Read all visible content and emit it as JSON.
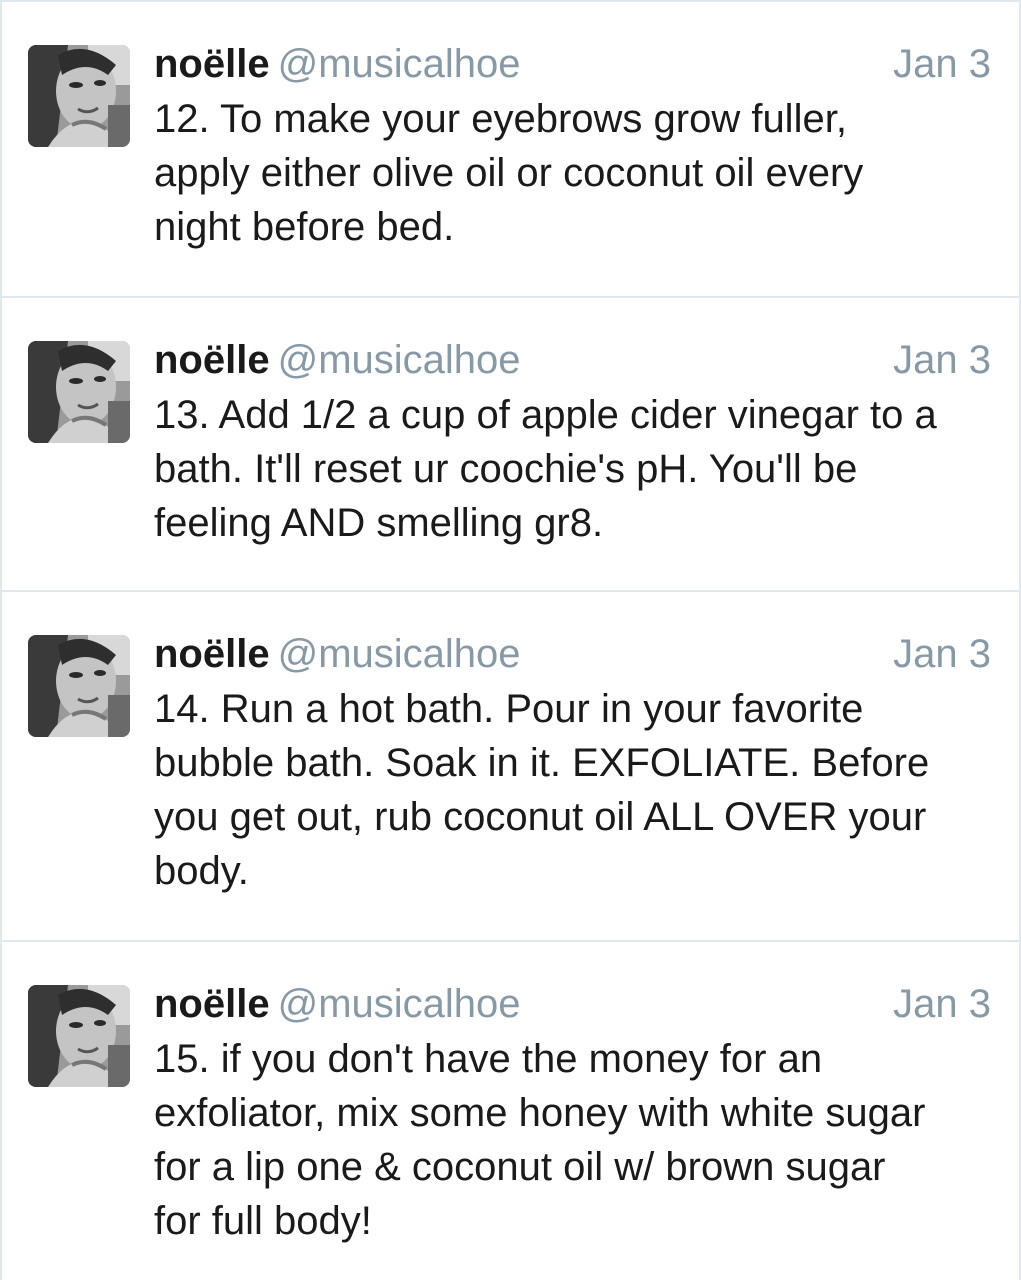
{
  "colors": {
    "border": "#e1e8ed",
    "name": "#1a1a1a",
    "handle": "#8899a6",
    "date": "#8899a6",
    "text": "#1a1a1a"
  },
  "tweets": [
    {
      "name": "noëlle",
      "handle": "@musicalhoe",
      "date": "Jan 3",
      "avatar_icon": "profile-photo-grayscale",
      "text": "12. To make your eyebrows grow fuller,\napply either olive oil or coconut oil every\nnight before bed."
    },
    {
      "name": "noëlle",
      "handle": "@musicalhoe",
      "date": "Jan 3",
      "avatar_icon": "profile-photo-grayscale",
      "text": "13. Add 1/2 a cup of apple cider vinegar to a\nbath. It'll reset ur coochie's pH. You'll be\nfeeling AND smelling gr8."
    },
    {
      "name": "noëlle",
      "handle": "@musicalhoe",
      "date": "Jan 3",
      "avatar_icon": "profile-photo-grayscale",
      "text": "14. Run a hot bath. Pour in your favorite\nbubble bath. Soak in it. EXFOLIATE. Before\nyou get out, rub coconut oil ALL OVER your\nbody."
    },
    {
      "name": "noëlle",
      "handle": "@musicalhoe",
      "date": "Jan 3",
      "avatar_icon": "profile-photo-grayscale",
      "text": "15. if you don't have the money for an\nexfoliator, mix some honey with white sugar\nfor a lip one & coconut oil w/ brown sugar\nfor full body!"
    }
  ]
}
